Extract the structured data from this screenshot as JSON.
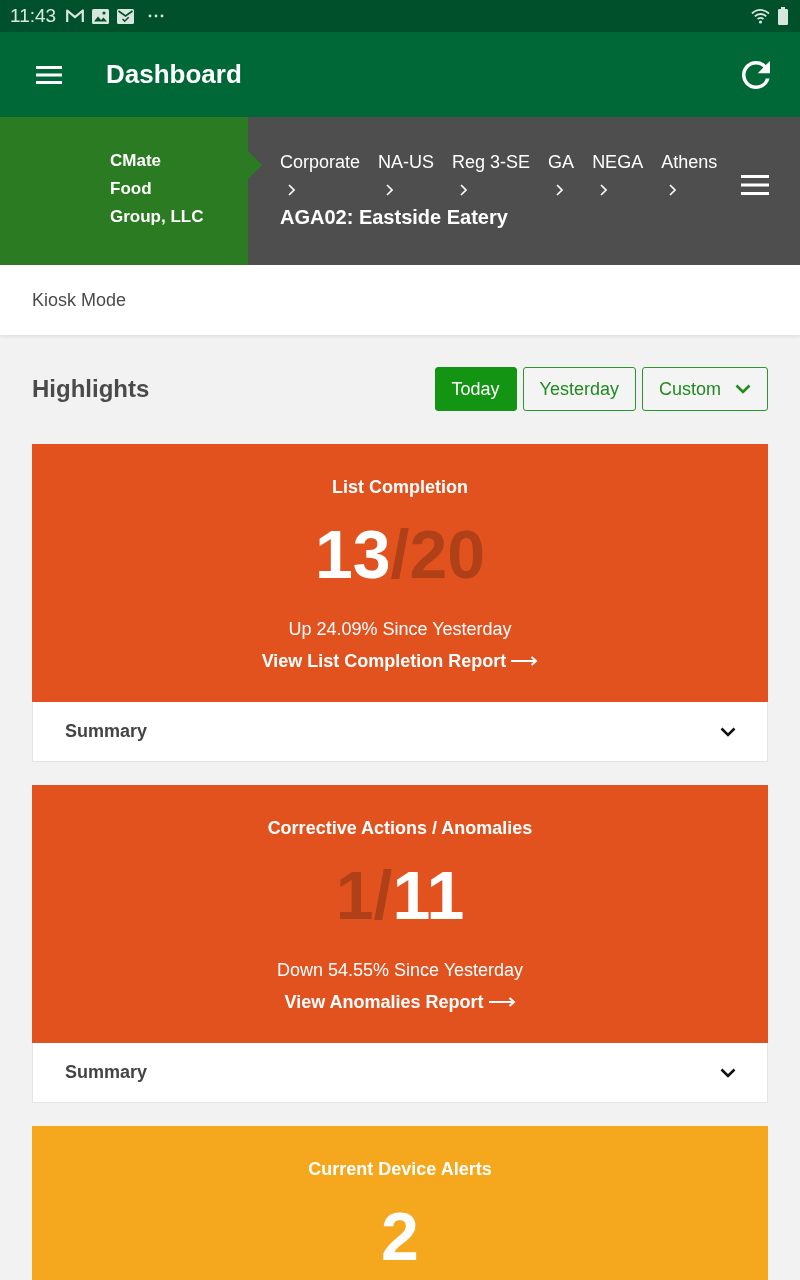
{
  "status_bar": {
    "time": "11:43"
  },
  "app_bar": {
    "title": "Dashboard"
  },
  "location": {
    "organization": "CMate Food Group, LLC",
    "breadcrumbs": [
      "Corporate",
      "NA-US",
      "Reg 3-SE",
      "GA",
      "NEGA",
      "Athens"
    ],
    "current": "AGA02: Eastside Eatery"
  },
  "mode_bar": {
    "label": "Kiosk Mode"
  },
  "highlights": {
    "title": "Highlights",
    "ranges": [
      {
        "label": "Today",
        "kind": "button",
        "selected": true
      },
      {
        "label": "Yesterday",
        "kind": "button",
        "selected": false
      },
      {
        "label": "Custom",
        "kind": "dropdown",
        "selected": false
      }
    ]
  },
  "cards": [
    {
      "title": "List Completion",
      "color": "#e2521e",
      "value_parts": [
        {
          "text": "13",
          "highlighted": true
        },
        {
          "text": "/20",
          "highlighted": false
        }
      ],
      "trend": "Up 24.09% Since Yesterday",
      "link": "View List Completion Report",
      "summary": {
        "label": "Summary",
        "expanded": false
      }
    },
    {
      "title": "Corrective Actions / Anomalies",
      "color": "#e2521e",
      "value_parts": [
        {
          "text": "1/",
          "highlighted": false
        },
        {
          "text": "11",
          "highlighted": true
        }
      ],
      "trend": "Down 54.55% Since Yesterday",
      "link": "View Anomalies Report",
      "summary": {
        "label": "Summary",
        "expanded": false
      }
    },
    {
      "title": "Current Device Alerts",
      "color": "#f5a71e",
      "value_parts": [
        {
          "text": "2",
          "highlighted": true
        }
      ]
    }
  ]
}
